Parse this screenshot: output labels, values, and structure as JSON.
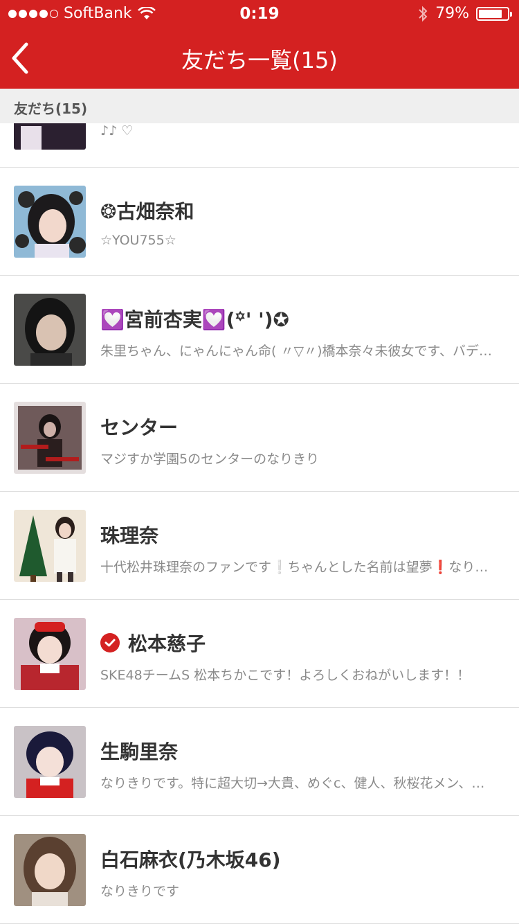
{
  "statusbar": {
    "carrier": "SoftBank",
    "time": "0:19",
    "battery": "79%",
    "battery_level": 0.79,
    "signal_bars": 4
  },
  "nav": {
    "title": "友だち一覧(15)",
    "back_icon": "chevron-left-icon"
  },
  "section": {
    "label": "友だち(15)"
  },
  "colors": {
    "accent": "#d42121",
    "section_bg": "#efefef"
  },
  "friends": [
    {
      "name": "",
      "status": "♪♪  ♡",
      "verified": false
    },
    {
      "name": "❂古畑奈和",
      "status": "☆YOU755☆",
      "verified": false
    },
    {
      "name": "💟宮前杏実💟(꙳' ')✪",
      "status": "朱里ちゃん、にゃんにゃん命( 〃▽〃)橋本奈々未彼女です、バデ…",
      "verified": false
    },
    {
      "name": "センター",
      "status": "マジすか学園5のセンターのなりきり",
      "verified": false
    },
    {
      "name": "珠理奈",
      "status": "十代松井珠理奈のファンです❕ちゃんとした名前は望夢❗なり…",
      "verified": false
    },
    {
      "name": "松本慈子",
      "status": "SKE48チームS 松本ちかこです！よろしくおねがいします！！",
      "verified": true
    },
    {
      "name": "生駒里奈",
      "status": "なりきりです。特に超大切→大貴、めぐc、健人、秋桜花メン、…",
      "verified": false
    },
    {
      "name": "白石麻衣(乃木坂46)",
      "status": "なりきりです",
      "verified": false
    }
  ]
}
